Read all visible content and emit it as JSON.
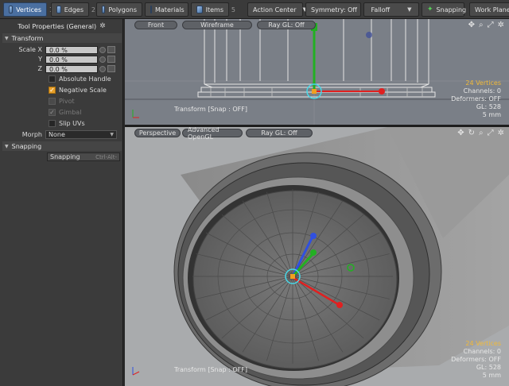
{
  "toolbar": {
    "modes": [
      {
        "label": "Vertices",
        "num": "1"
      },
      {
        "label": "Edges",
        "num": "2"
      },
      {
        "label": "Polygons",
        "num": "3"
      },
      {
        "label": "Materials",
        "num": ""
      },
      {
        "label": "Items",
        "num": "5"
      }
    ],
    "action_center": "Action Center",
    "symmetry": "Symmetry: Off",
    "falloff": "Falloff",
    "snapping": "Snapping",
    "work_plane": "Work Plane"
  },
  "panel": {
    "title": "Tool Properties (General)",
    "transform_section": "Transform",
    "scale_x_label": "Scale X",
    "scale_x": "0.0 %",
    "y_label": "Y",
    "scale_y": "0.0 %",
    "z_label": "Z",
    "scale_z": "0.0 %",
    "absolute_handle": "Absolute Handle",
    "negative_scale": "Negative Scale",
    "pivot": "Pivot",
    "gimbal": "Gimbal",
    "slip_uvs": "Slip UVs",
    "morph_label": "Morph",
    "morph_value": "None",
    "snapping_section": "Snapping",
    "snapping_btn": "Snapping",
    "snapping_shortcut": "Ctrl-Alt-"
  },
  "top_viewport": {
    "view_label": "Front",
    "shading_label": "Wireframe",
    "raygl_label": "Ray GL: Off",
    "vertices": "24 Vertices",
    "channels": "Channels: 0",
    "deformers": "Deformers: OFF",
    "gl": "GL: 528",
    "unit": "5 mm",
    "status": "Transform  [Snap : OFF]"
  },
  "bottom_viewport": {
    "view_label": "Perspective",
    "shading_label": "Advanced OpenGL",
    "raygl_label": "Ray GL: Off",
    "vertices": "24 Vertices",
    "channels": "Channels: 0",
    "deformers": "Deformers: OFF",
    "gl": "GL: 528",
    "unit": "5 mm",
    "status": "Transform  [Snap : OFF]"
  },
  "colors": {
    "accent": "#4a6fa0",
    "highlight": "#f0b93a",
    "axis_x": "#e02020",
    "axis_y": "#20b020",
    "axis_z": "#3050e0"
  },
  "icons": [
    "vertices-icon",
    "edges-icon",
    "polygons-icon",
    "materials-icon",
    "items-icon",
    "snapping-icon",
    "gear-icon",
    "move-icon",
    "rotate-icon",
    "zoom-icon",
    "maximize-icon"
  ]
}
